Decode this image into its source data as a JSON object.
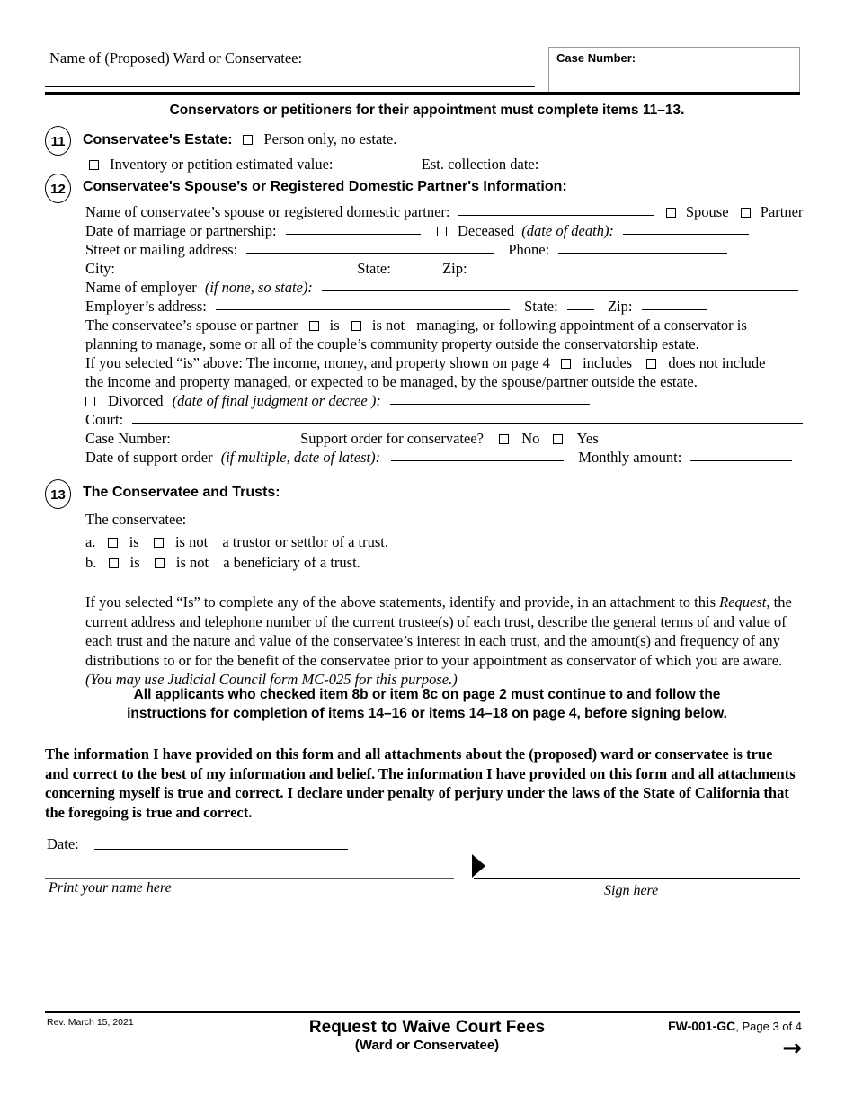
{
  "header": {
    "ward_label": "Name of (Proposed) Ward or Conservatee:",
    "case_number_label": "Case Number:"
  },
  "banner": "Conservators or petitioners for their appointment must complete items 11–13.",
  "item11": {
    "number": "11",
    "heading": "Conservatee's Estate:",
    "person_only_label": "Person only, no estate.",
    "inventory_label": "Inventory or petition estimated value:",
    "est_collection_label": "Est. collection date:"
  },
  "item12": {
    "number": "12",
    "heading": "Conservatee's Spouse’s or Registered Domestic Partner's Information:",
    "name_label": "Name of conservatee’s spouse or registered domestic partner:",
    "spouse_label": "Spouse",
    "partner_label": "Partner",
    "marriage_label": "Date of marriage or partnership:",
    "deceased_label": "Deceased",
    "deceased_italic": "(date of death):",
    "street_label": "Street or mailing address:",
    "phone_label": "Phone:",
    "city_label": "City:",
    "state_label": "State:",
    "zip_label": "Zip:",
    "employer_label": "Name of employer",
    "employer_italic": "(if none, so state):",
    "employer_address_label": "Employer’s address:",
    "employer_state_label": "State:",
    "employer_zip_label": "Zip:",
    "managing_pre": "The conservatee’s spouse or partner",
    "managing_is": "is",
    "managing_is_not": "is not",
    "managing_post": "managing, or following appointment of a conservator is",
    "managing_line2": "planning to manage, some or all of the couple’s community property outside the conservatorship estate.",
    "income_pre": "If you selected “is” above:  The income, money, and property shown on page 4",
    "income_includes": "includes",
    "income_not_includes": "does not include",
    "income_line2": "the income and property managed, or expected to be managed, by the spouse/partner outside the estate.",
    "divorced_label": "Divorced",
    "divorced_italic": "(date of final judgment or decree ):",
    "court_label": "Court:",
    "case_number_label": "Case Number:",
    "support_order_label": "Support order for conservatee?",
    "support_no": "No",
    "support_yes": "Yes",
    "support_date_label": "Date of support order",
    "support_date_italic": "(if multiple, date of latest):",
    "monthly_amount_label": "Monthly amount:"
  },
  "item13": {
    "number": "13",
    "heading": "The Conservatee and Trusts:",
    "intro": "The conservatee:",
    "a_marker": "a.",
    "a_is": "is",
    "a_is_not": "is not",
    "a_text": "a trustor or settlor of a trust.",
    "b_marker": "b.",
    "b_is": "is",
    "b_is_not": "is not",
    "b_text": "a beneficiary of a trust.",
    "paragraph_pre": "If you selected “Is” to complete any of the above statements, identify and provide, in an attachment to this ",
    "paragraph_italic1": "Request",
    "paragraph_mid": ", the current address and telephone number of the current trustee(s) of each trust, describe the general terms of and value of each trust and the nature and value of the conservatee’s interest in each trust, and the amount(s) and frequency of any distributions to or for the benefit of the conservatee prior to your appointment as conservator of which you are aware. ",
    "paragraph_italic2": "(You may use Judicial Council form MC-025 for this purpose.)"
  },
  "notice": {
    "line1": "All applicants who checked item 8b or item 8c on page 2 must continue to and follow the",
    "line2": "instructions for completion of items 14–16 or items 14–18 on page 4, before signing below."
  },
  "declaration": "The information I have provided on this form and all attachments about the (proposed) ward or conservatee is true and correct to the best of my information and belief. The information I have provided on this form and all attachments concerning myself is true and correct. I declare under penalty of perjury under the laws of the State of California that the foregoing is true and correct.",
  "signature": {
    "date_label": "Date:",
    "print_name_caption": "Print your name here",
    "sign_caption": "Sign here"
  },
  "footer": {
    "revision": "Rev. March 15, 2021",
    "title": "Request to Waive Court Fees",
    "subtitle": "(Ward or Conservatee)",
    "form_code": "FW-001-GC",
    "page_info": ", Page 3 of 4",
    "next_arrow": "→"
  }
}
